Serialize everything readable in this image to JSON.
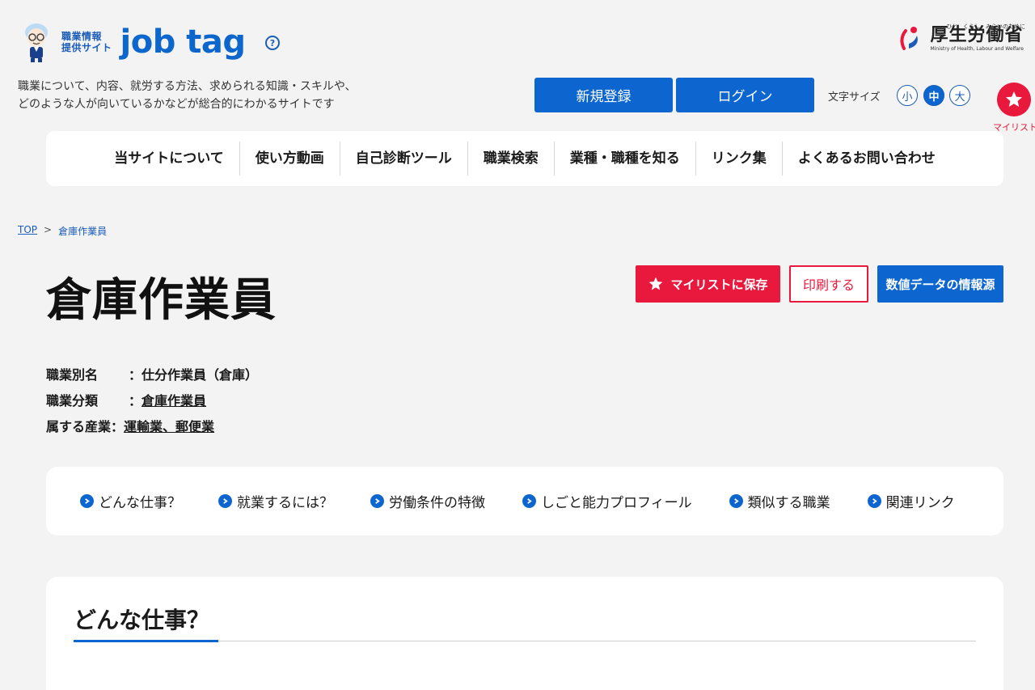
{
  "header": {
    "logo_small_line1": "職業情報",
    "logo_small_line2": "提供サイト",
    "logo_main": "job tag",
    "help": "?",
    "ministry_sub": "ひと、くらし、みらいのために",
    "ministry_name": "厚生労働省",
    "ministry_en": "Ministry of Health, Labour and Welfare",
    "tagline_line1": "職業について、内容、就労する方法、求められる知識・スキルや、",
    "tagline_line2": "どのような人が向いているかなどが総合的にわかるサイトです",
    "register_label": "新規登録",
    "login_label": "ログイン",
    "fontsize_label": "文字サイズ",
    "fontsize_small": "小",
    "fontsize_mid": "中",
    "fontsize_large": "大",
    "mylist_label": "マイリスト"
  },
  "nav": {
    "items": [
      "当サイトについて",
      "使い方動画",
      "自己診断ツール",
      "職業検索",
      "業種・職種を知る",
      "リンク集",
      "よくあるお問い合わせ"
    ]
  },
  "breadcrumb": {
    "top": "TOP",
    "sep": ">",
    "current": "倉庫作業員"
  },
  "page": {
    "title": "倉庫作業員",
    "save_label": "マイリストに保存",
    "print_label": "印刷する",
    "data_label": "数値データの情報源"
  },
  "meta": {
    "alias_label": "職業別名",
    "alias_value": "：仕分作業員（倉庫）",
    "category_label": "職業分類",
    "category_sep": "：",
    "category_value": "倉庫作業員",
    "industry_label": "属する産業",
    "industry_sep": "：",
    "industry_value": "運輸業、郵便業"
  },
  "anchors": {
    "items": [
      "どんな仕事？",
      "就業するには？",
      "労働条件の特徴",
      "しごと能力プロフィール",
      "類似する職業",
      "関連リンク"
    ]
  },
  "section": {
    "title": "どんな仕事？"
  },
  "colors": {
    "primary_blue": "#0d66d0",
    "accent_red": "#e8193c",
    "background": "#f3f3f3"
  }
}
